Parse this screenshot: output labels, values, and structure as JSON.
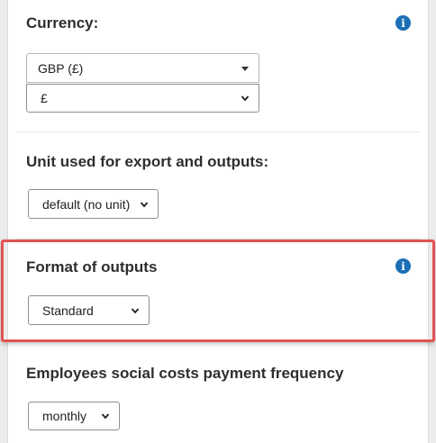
{
  "currency": {
    "label": "Currency:",
    "currency_select_value": "GBP (£)",
    "symbol_select_value": "£"
  },
  "unit": {
    "label": "Unit used for export and outputs:",
    "select_value": "default (no unit)"
  },
  "format": {
    "label": "Format of outputs",
    "select_value": "Standard"
  },
  "social_costs": {
    "label": "Employees social costs payment frequency",
    "select_value": "monthly"
  },
  "icons": {
    "info": "info-icon",
    "dropdown": "caret-down-icon",
    "native_dropdown": "chevron-down-icon"
  },
  "colors": {
    "info_icon": "#1c6fb5",
    "highlight_border": "#e05353"
  }
}
